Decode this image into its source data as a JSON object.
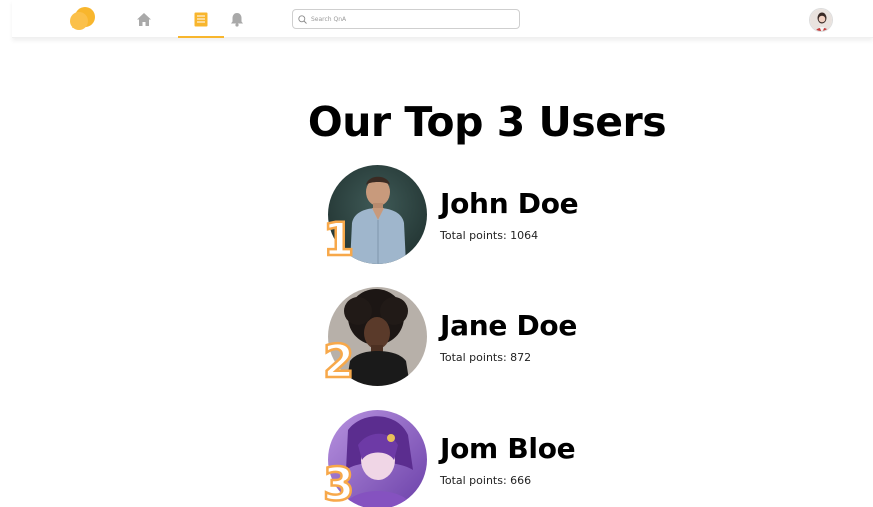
{
  "colors": {
    "accent": "#f8b62d",
    "rank_outline": "#f7a84a",
    "nav_icon": "#a9a9a9"
  },
  "header": {
    "logo_icon": "speech-bubbles-logo",
    "nav": [
      {
        "id": "home",
        "icon": "home-icon",
        "active": false
      },
      {
        "id": "list",
        "icon": "list-icon",
        "active": true
      },
      {
        "id": "notifications",
        "icon": "bell-icon",
        "active": false
      }
    ],
    "search": {
      "placeholder": "Search QnA",
      "value": ""
    },
    "avatar_icon": "user-avatar"
  },
  "main": {
    "title": "Our Top 3 Users",
    "users": [
      {
        "rank": "1",
        "name": "John Doe",
        "points": "Total points: 1064"
      },
      {
        "rank": "2",
        "name": "Jane Doe",
        "points": "Total points: 872"
      },
      {
        "rank": "3",
        "name": "Jom Bloe",
        "points": "Total points: 666"
      }
    ]
  }
}
